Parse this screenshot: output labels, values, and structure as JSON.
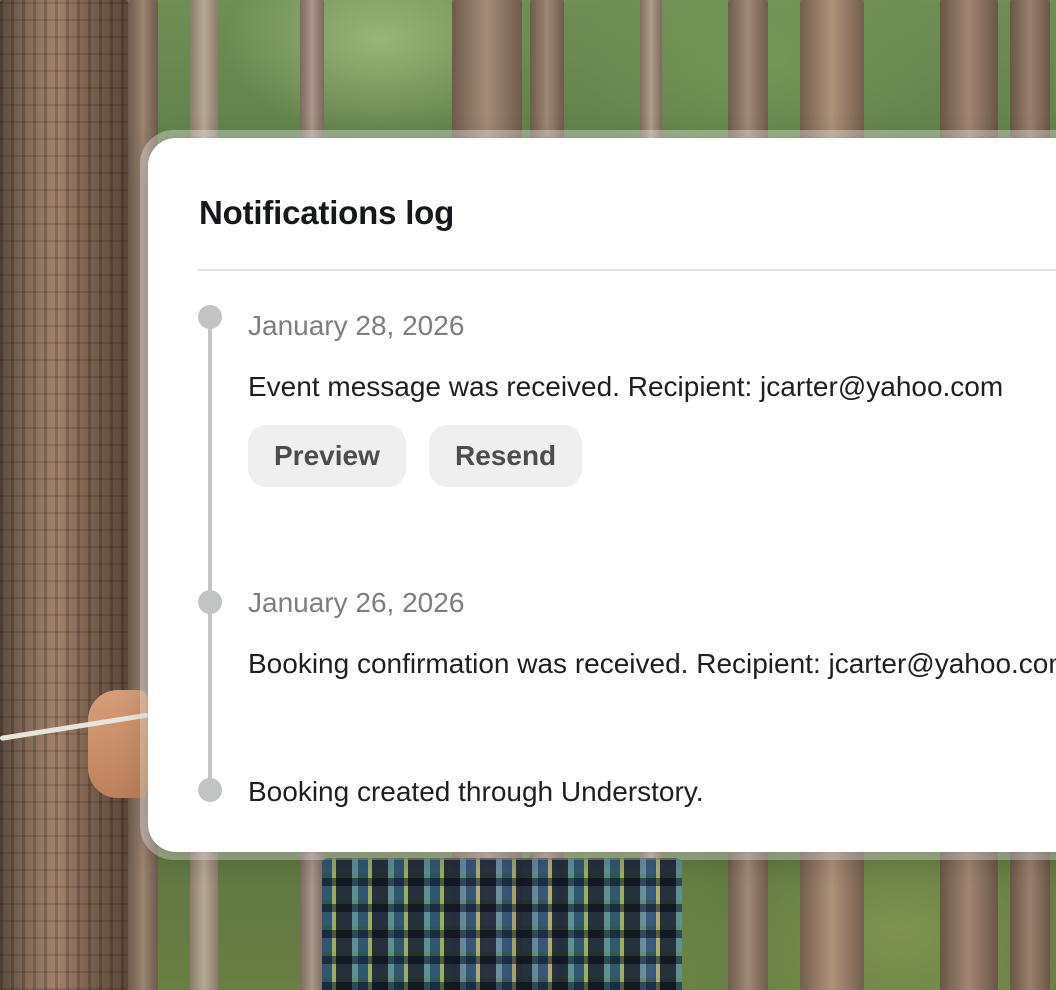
{
  "panel": {
    "title": "Notifications log",
    "entries": [
      {
        "date": "January 28, 2026",
        "text": "Event message was received. Recipient: jcarter@yahoo.com",
        "actions": [
          "Preview",
          "Resend"
        ]
      },
      {
        "date": "January 26, 2026",
        "text": "Booking confirmation was received. Recipient: jcarter@yahoo.com"
      },
      {
        "text": "Booking created through Understory."
      }
    ]
  },
  "colors": {
    "card_background": "#ffffff",
    "title_text": "#15171a",
    "date_text": "#7e7e7e",
    "timeline": "#c4c4c4",
    "button_background": "#efefef",
    "button_text": "#4c4c4c"
  },
  "icons": [
    "timeline-dot-icon"
  ]
}
